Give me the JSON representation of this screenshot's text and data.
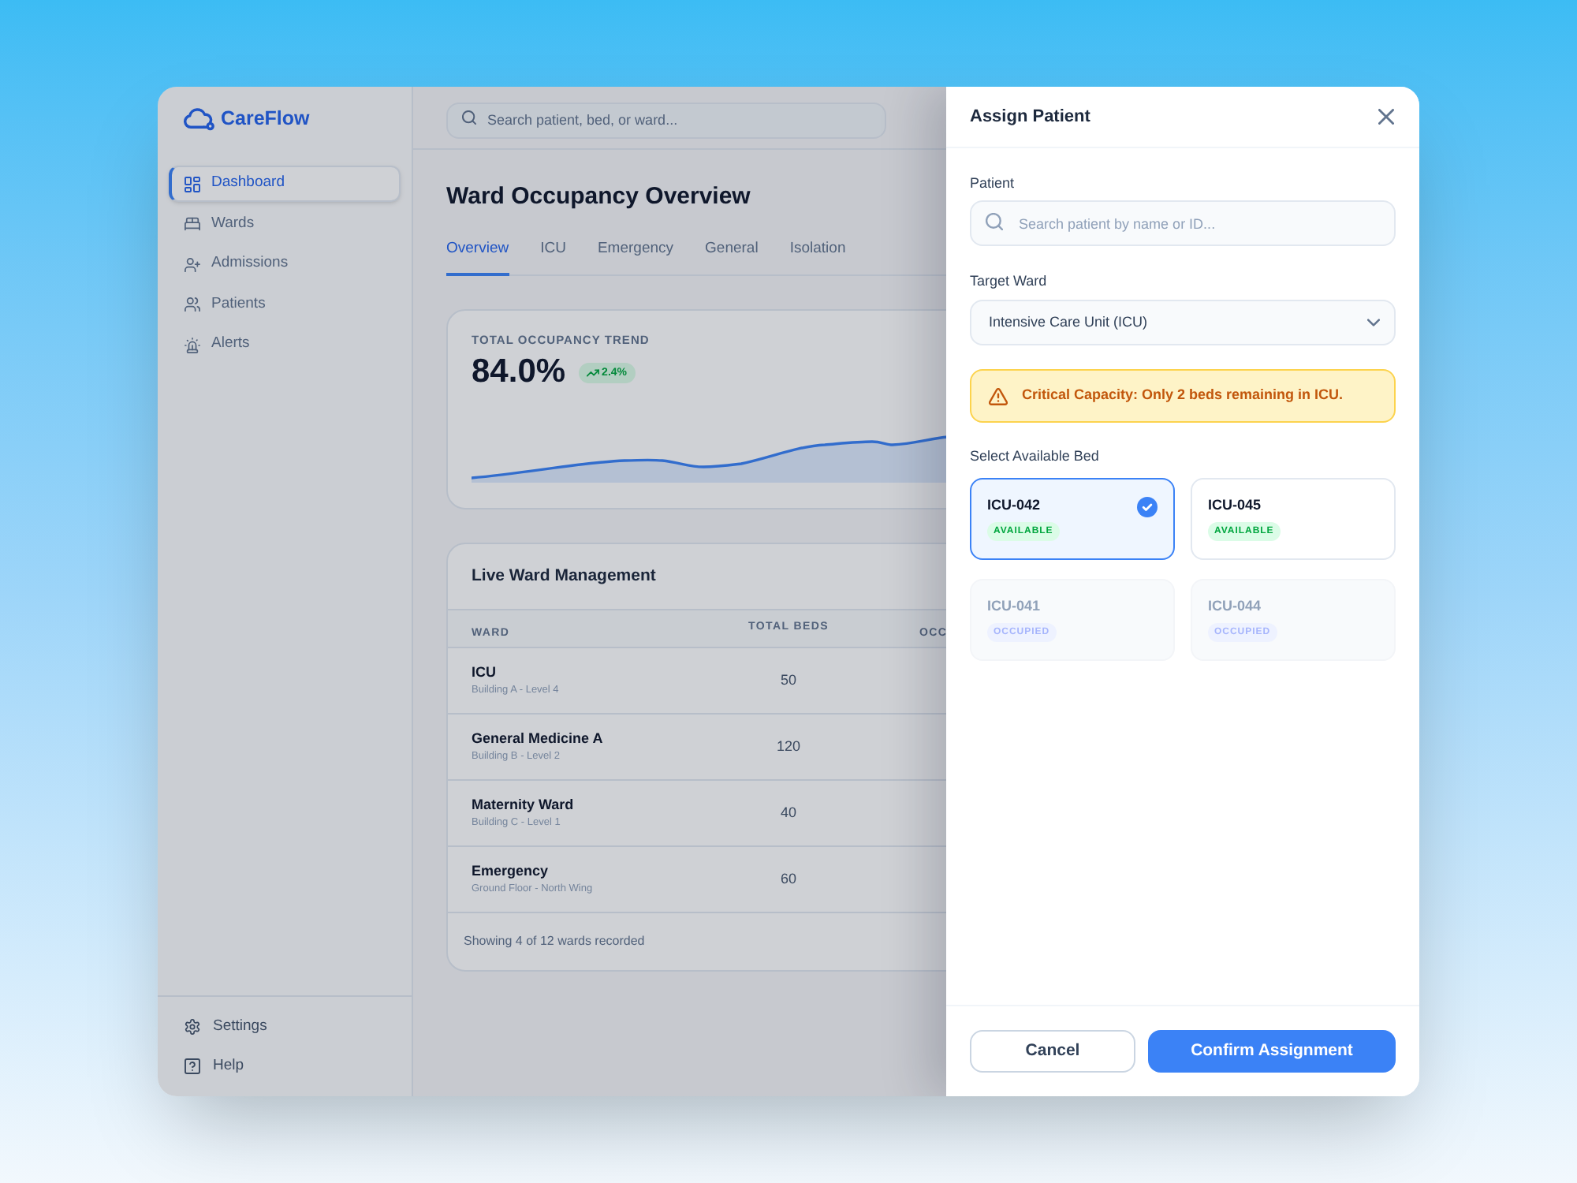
{
  "sidebar": {
    "brand": "CareFlow",
    "nav": [
      {
        "label": "Dashboard",
        "selected": true
      },
      {
        "label": "Wards",
        "selected": false
      },
      {
        "label": "Admissions",
        "selected": false
      },
      {
        "label": "Patients",
        "selected": false
      },
      {
        "label": "Alerts",
        "selected": false
      }
    ],
    "footer_nav": [
      "Settings",
      "Help"
    ]
  },
  "top_bar": {
    "search": {
      "placeholder": "Search patient, bed, or ward..."
    }
  },
  "page": {
    "title": "Ward Occupancy Overview",
    "tabs": [
      {
        "label": "Overview",
        "selected": true
      },
      {
        "label": "ICU",
        "selected": false
      },
      {
        "label": "Emergency",
        "selected": false
      },
      {
        "label": "General",
        "selected": false
      },
      {
        "label": "Isolation",
        "selected": false
      }
    ]
  },
  "trend_card": {
    "label": "TOTAL OCCUPANCY TREND",
    "value": "84.0%",
    "change": "2.4%"
  },
  "ward_table": {
    "title": "Live Ward Management",
    "columns": [
      "WARD",
      "TOTAL BEDS",
      "OCC"
    ],
    "rows": [
      {
        "ward": "ICU",
        "location": "Building A - Level 4",
        "total_beds": "50"
      },
      {
        "ward": "General Medicine A",
        "location": "Building B - Level 2",
        "total_beds": "120"
      },
      {
        "ward": "Maternity Ward",
        "location": "Building C - Level 1",
        "total_beds": "40"
      },
      {
        "ward": "Emergency",
        "location": "Ground Floor - North Wing",
        "total_beds": "60"
      }
    ],
    "footer": "Showing 4 of 12 wards recorded"
  },
  "modal": {
    "title": "Assign Patient",
    "patient": {
      "label": "Patient",
      "placeholder": "Search patient by name or ID..."
    },
    "ward": {
      "label": "Target Ward",
      "value": "Intensive Care Unit (ICU)"
    },
    "alert": "Critical Capacity: Only 2 beds remaining in ICU.",
    "beds_label": "Select Available Bed",
    "beds": [
      {
        "id": "ICU-042",
        "status": "AVAILABLE",
        "kind": "available",
        "selected": true
      },
      {
        "id": "ICU-045",
        "status": "AVAILABLE",
        "kind": "available",
        "selected": false
      },
      {
        "id": "ICU-041",
        "status": "OCCUPIED",
        "kind": "occupied",
        "selected": false
      },
      {
        "id": "ICU-044",
        "status": "OCCUPIED",
        "kind": "occupied",
        "selected": false
      }
    ],
    "buttons": [
      {
        "label": "Cancel",
        "kind": "secondary"
      },
      {
        "label": "Confirm Assignment",
        "kind": "primary"
      }
    ]
  }
}
